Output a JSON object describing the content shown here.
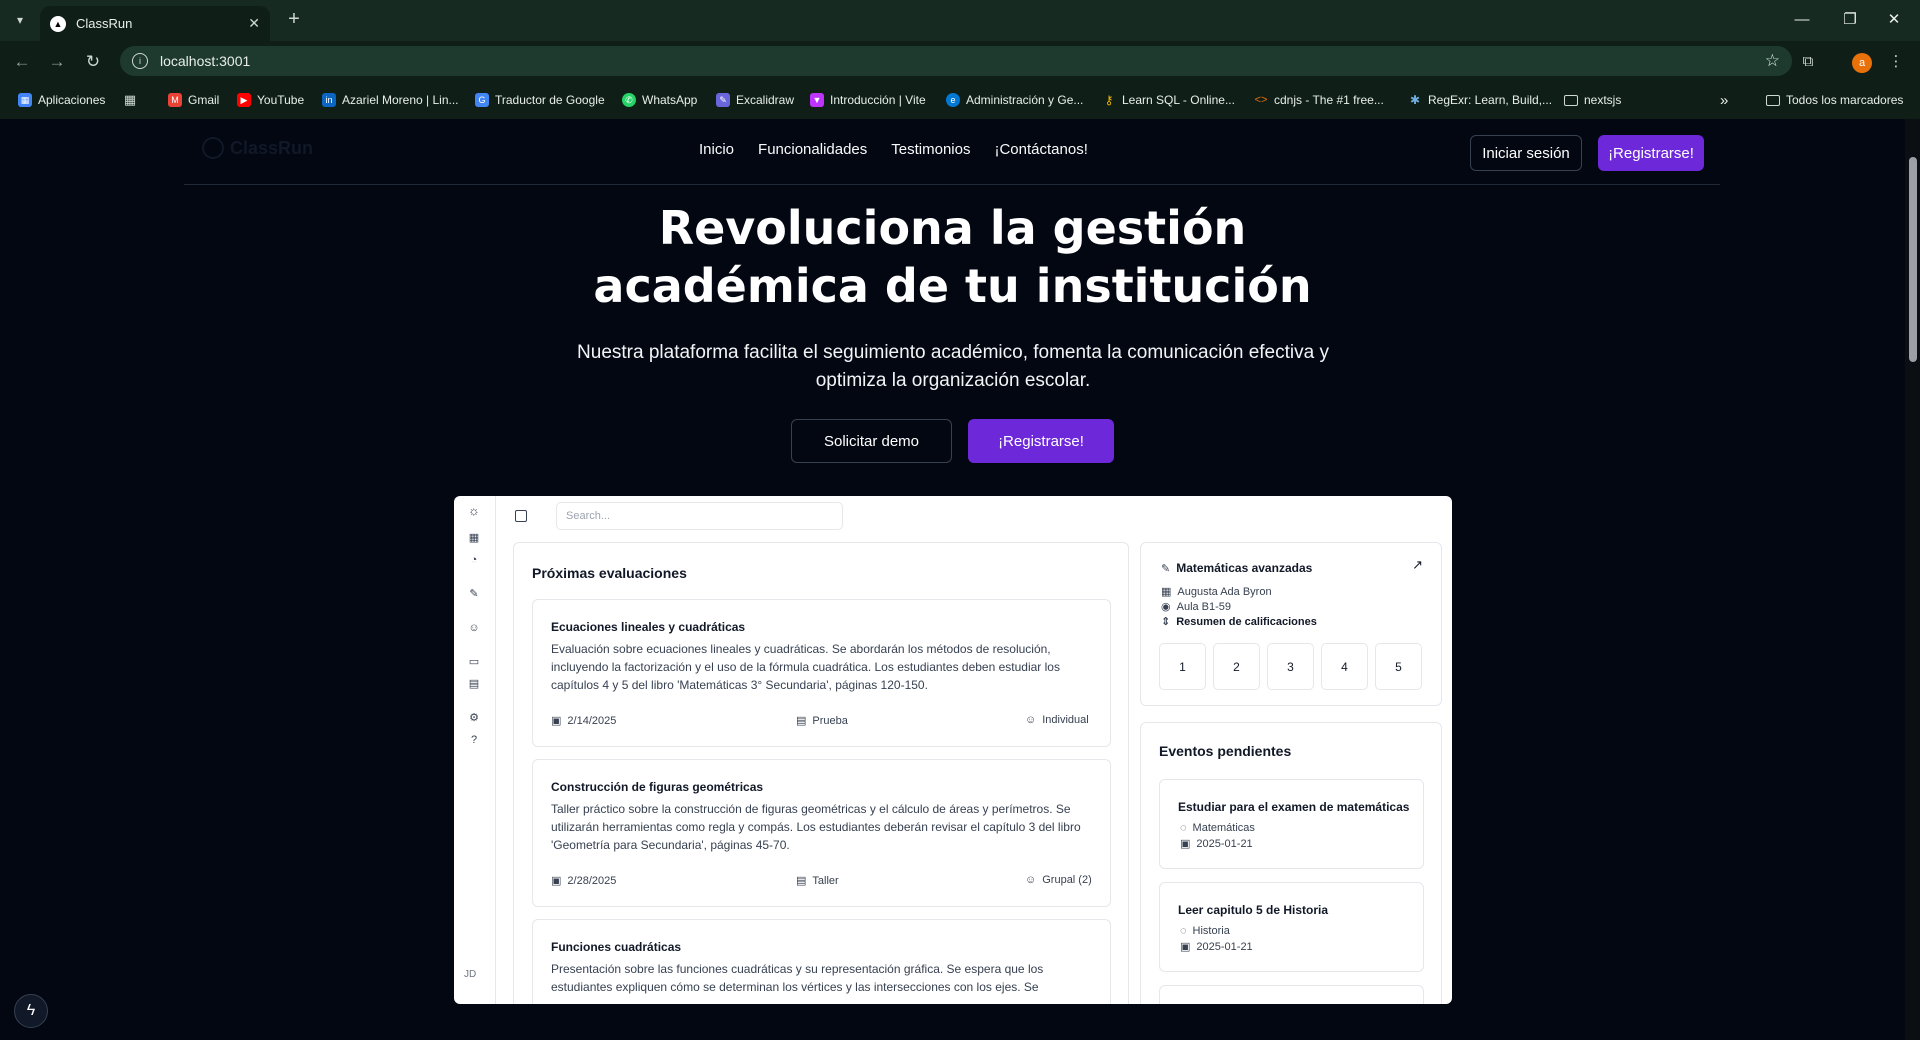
{
  "browser": {
    "tab_title": "ClassRun",
    "url": "localhost:3001",
    "profile_initial": "a",
    "bookmarks": [
      {
        "label": "Aplicaciones",
        "icon": "apps-grid-icon",
        "color": "#4285f4"
      },
      {
        "label": "",
        "icon": "grid-icon",
        "color": "#5f6368"
      },
      {
        "label": "Gmail",
        "icon": "gmail-icon",
        "color": "#ea4335"
      },
      {
        "label": "YouTube",
        "icon": "youtube-icon",
        "color": "#ff0000"
      },
      {
        "label": "Azariel Moreno | Lin...",
        "icon": "linkedin-icon",
        "color": "#0a66c2"
      },
      {
        "label": "Traductor de Google",
        "icon": "google-translate-icon",
        "color": "#4285f4"
      },
      {
        "label": "WhatsApp",
        "icon": "whatsapp-icon",
        "color": "#25d366"
      },
      {
        "label": "Excalidraw",
        "icon": "excalidraw-icon",
        "color": "#6965db"
      },
      {
        "label": "Introducción | Vite",
        "icon": "vite-icon",
        "color": "#bd34fe"
      },
      {
        "label": "Administración y Ge...",
        "icon": "edge-icon",
        "color": "#0078d4"
      },
      {
        "label": "Learn SQL - Online...",
        "icon": "key-icon",
        "color": "#f4b400"
      },
      {
        "label": "cdnjs - The #1 free...",
        "icon": "code-icon",
        "color": "#e8710a"
      },
      {
        "label": "RegExr: Learn, Build,...",
        "icon": "regexr-icon",
        "color": "#70b0e0"
      },
      {
        "label": "nextsjs",
        "icon": "folder-icon",
        "color": "#cfd8d3"
      }
    ],
    "all_bookmarks": "Todos los marcadores"
  },
  "site": {
    "logo": "ClassRun",
    "nav": [
      "Inicio",
      "Funcionalidades",
      "Testimonios",
      "¡Contáctanos!"
    ],
    "login": "Iniciar sesión",
    "register": "¡Registrarse!"
  },
  "hero": {
    "title_line1": "Revoluciona la gestión",
    "title_line2": "académica de tu institución",
    "subtitle": "Nuestra plataforma facilita el seguimiento académico, fomenta la comunicación efectiva y optimiza la organización escolar.",
    "demo_button": "Solicitar demo",
    "register_button": "¡Registrarse!"
  },
  "dashboard": {
    "search_placeholder": "Search...",
    "avatar": "JD",
    "evaluations": {
      "title": "Próximas evaluaciones",
      "items": [
        {
          "title": "Ecuaciones lineales y cuadráticas",
          "description": "Evaluación sobre ecuaciones lineales y cuadráticas. Se abordarán los métodos de resolución, incluyendo la factorización y el uso de la fórmula cuadrática. Los estudiantes deben estudiar los capítulos 4 y 5 del libro 'Matemáticas 3° Secundaria', páginas 120-150.",
          "date": "2/14/2025",
          "type": "Prueba",
          "mode": "Individual"
        },
        {
          "title": "Construcción de figuras geométricas",
          "description": "Taller práctico sobre la construcción de figuras geométricas y el cálculo de áreas y perímetros. Se utilizarán herramientas como regla y compás. Los estudiantes deberán revisar el capítulo 3 del libro 'Geometría para Secundaria', páginas 45-70.",
          "date": "2/28/2025",
          "type": "Taller",
          "mode": "Grupal (2)"
        },
        {
          "title": "Funciones cuadráticas",
          "description": "Presentación sobre las funciones cuadráticas y su representación gráfica. Se espera que los estudiantes expliquen cómo se determinan los vértices y las intersecciones con los ejes. Se",
          "date": "",
          "type": "",
          "mode": ""
        }
      ]
    },
    "subject": {
      "title": "Matemáticas avanzadas",
      "teacher": "Augusta Ada Byron",
      "room": "Aula B1-59",
      "grades_label": "Resumen de calificaciones",
      "grades": [
        "1",
        "2",
        "3",
        "4",
        "5"
      ]
    },
    "events": {
      "title": "Eventos pendientes",
      "items": [
        {
          "title": "Estudiar para el examen de matemáticas",
          "subject": "Matemáticas",
          "date": "2025-01-21"
        },
        {
          "title": "Leer capitulo 5 de Historia",
          "subject": "Historia",
          "date": "2025-01-21"
        }
      ]
    }
  }
}
